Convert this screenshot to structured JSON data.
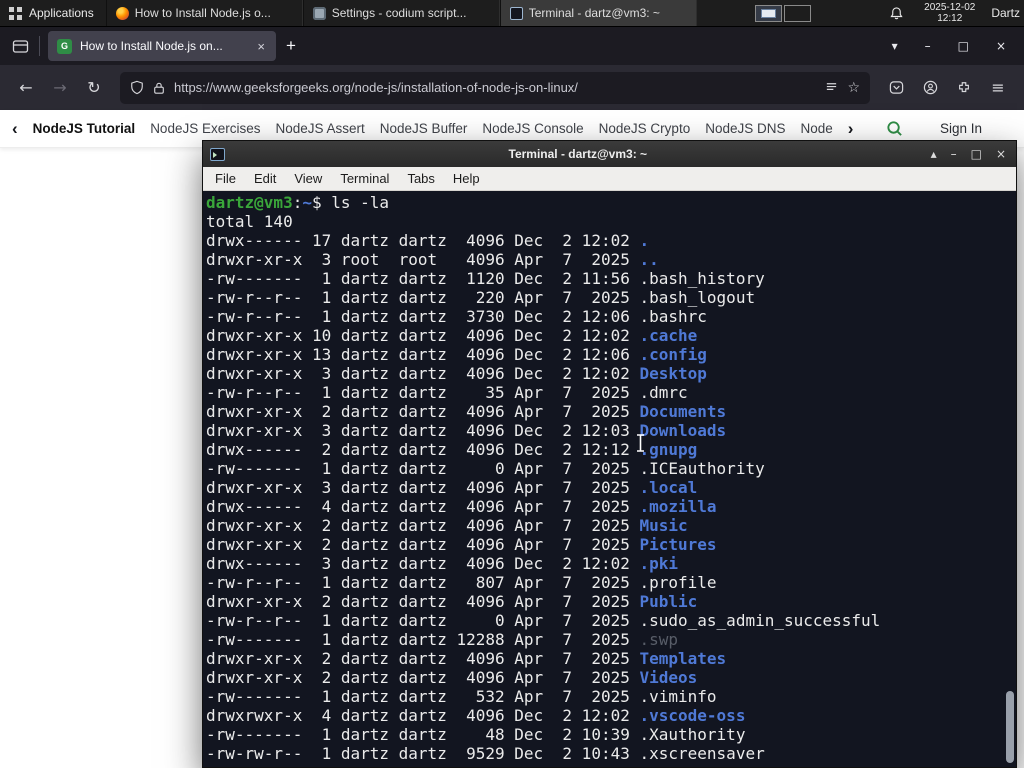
{
  "colors": {
    "gfg_green": "#2f8d46",
    "terminal_dir_blue": "#4f79d6",
    "terminal_prompt_green": "#3aa63a",
    "terminal_background": "#121520"
  },
  "panel": {
    "applications_label": "Applications",
    "tasks": [
      {
        "label": "How to Install Node.js o...",
        "icon": "firefox",
        "active": false
      },
      {
        "label": "Settings - codium script...",
        "icon": "settings",
        "active": false
      },
      {
        "label": "Terminal - dartz@vm3: ~",
        "icon": "terminal",
        "active": true
      }
    ],
    "clock": {
      "date": "2025-12-02",
      "time": "12:12"
    },
    "user": "Dartz"
  },
  "browser": {
    "tab": {
      "title": "How to Install Node.js on...",
      "favicon_letter": "G",
      "close_glyph": "×"
    },
    "new_tab_label": "+",
    "window_controls": {
      "list_tabs": "▾",
      "minimize": "–",
      "maximize": "□",
      "close": "×"
    },
    "url": "https://www.geeksforgeeks.org/node-js/installation-of-node-js-on-linux/",
    "toolbar_glyphs": {
      "back": "←",
      "forward": "→",
      "reload": "↻",
      "bookmark": "☆",
      "menu": "≡"
    },
    "gfg_nav": {
      "scroll_left": "‹",
      "scroll_right": "›",
      "links": [
        {
          "label": "NodeJS Tutorial",
          "bold": true
        },
        {
          "label": "NodeJS Exercises",
          "bold": false
        },
        {
          "label": "NodeJS Assert",
          "bold": false
        },
        {
          "label": "NodeJS Buffer",
          "bold": false
        },
        {
          "label": "NodeJS Console",
          "bold": false
        },
        {
          "label": "NodeJS Crypto",
          "bold": false
        },
        {
          "label": "NodeJS DNS",
          "bold": false
        },
        {
          "label": "Node",
          "bold": false
        }
      ],
      "sign_in": "Sign In"
    }
  },
  "terminal": {
    "title": "Terminal - dartz@vm3: ~",
    "menu": [
      "File",
      "Edit",
      "View",
      "Terminal",
      "Tabs",
      "Help"
    ],
    "window_controls": {
      "shade": "▴",
      "minimize": "–",
      "maximize": "□",
      "close": "×"
    },
    "prompt": {
      "userhost": "dartz@vm3",
      "colon": ":",
      "path": "~",
      "symbol": "$ ",
      "command": "ls -la"
    },
    "lines": [
      {
        "pre": "total 140",
        "name": "",
        "type": "plain"
      },
      {
        "pre": "drwx------ 17 dartz dartz  4096 Dec  2 12:02 ",
        "name": ".",
        "type": "dir"
      },
      {
        "pre": "drwxr-xr-x  3 root  root   4096 Apr  7  2025 ",
        "name": "..",
        "type": "dir"
      },
      {
        "pre": "-rw-------  1 dartz dartz  1120 Dec  2 11:56 ",
        "name": ".bash_history",
        "type": "file"
      },
      {
        "pre": "-rw-r--r--  1 dartz dartz   220 Apr  7  2025 ",
        "name": ".bash_logout",
        "type": "file"
      },
      {
        "pre": "-rw-r--r--  1 dartz dartz  3730 Dec  2 12:06 ",
        "name": ".bashrc",
        "type": "file"
      },
      {
        "pre": "drwxr-xr-x 10 dartz dartz  4096 Dec  2 12:02 ",
        "name": ".cache",
        "type": "dir"
      },
      {
        "pre": "drwxr-xr-x 13 dartz dartz  4096 Dec  2 12:06 ",
        "name": ".config",
        "type": "dir"
      },
      {
        "pre": "drwxr-xr-x  3 dartz dartz  4096 Dec  2 12:02 ",
        "name": "Desktop",
        "type": "dir"
      },
      {
        "pre": "-rw-r--r--  1 dartz dartz    35 Apr  7  2025 ",
        "name": ".dmrc",
        "type": "file"
      },
      {
        "pre": "drwxr-xr-x  2 dartz dartz  4096 Apr  7  2025 ",
        "name": "Documents",
        "type": "dir"
      },
      {
        "pre": "drwxr-xr-x  3 dartz dartz  4096 Dec  2 12:03 ",
        "name": "Downloads",
        "type": "dir"
      },
      {
        "pre": "drwx------  2 dartz dartz  4096 Dec  2 12:12 ",
        "name": ".gnupg",
        "type": "dir"
      },
      {
        "pre": "-rw-------  1 dartz dartz     0 Apr  7  2025 ",
        "name": ".ICEauthority",
        "type": "file"
      },
      {
        "pre": "drwxr-xr-x  3 dartz dartz  4096 Apr  7  2025 ",
        "name": ".local",
        "type": "dir"
      },
      {
        "pre": "drwx------  4 dartz dartz  4096 Apr  7  2025 ",
        "name": ".mozilla",
        "type": "dir"
      },
      {
        "pre": "drwxr-xr-x  2 dartz dartz  4096 Apr  7  2025 ",
        "name": "Music",
        "type": "dir"
      },
      {
        "pre": "drwxr-xr-x  2 dartz dartz  4096 Apr  7  2025 ",
        "name": "Pictures",
        "type": "dir"
      },
      {
        "pre": "drwx------  3 dartz dartz  4096 Dec  2 12:02 ",
        "name": ".pki",
        "type": "dir"
      },
      {
        "pre": "-rw-r--r--  1 dartz dartz   807 Apr  7  2025 ",
        "name": ".profile",
        "type": "file"
      },
      {
        "pre": "drwxr-xr-x  2 dartz dartz  4096 Apr  7  2025 ",
        "name": "Public",
        "type": "dir"
      },
      {
        "pre": "-rw-r--r--  1 dartz dartz     0 Apr  7  2025 ",
        "name": ".sudo_as_admin_successful",
        "type": "file"
      },
      {
        "pre": "-rw-------  1 dartz dartz 12288 Apr  7  2025 ",
        "name": ".swp",
        "type": "dim"
      },
      {
        "pre": "drwxr-xr-x  2 dartz dartz  4096 Apr  7  2025 ",
        "name": "Templates",
        "type": "dir"
      },
      {
        "pre": "drwxr-xr-x  2 dartz dartz  4096 Apr  7  2025 ",
        "name": "Videos",
        "type": "dir"
      },
      {
        "pre": "-rw-------  1 dartz dartz   532 Apr  7  2025 ",
        "name": ".viminfo",
        "type": "file"
      },
      {
        "pre": "drwxrwxr-x  4 dartz dartz  4096 Dec  2 12:02 ",
        "name": ".vscode-oss",
        "type": "dir"
      },
      {
        "pre": "-rw-------  1 dartz dartz    48 Dec  2 10:39 ",
        "name": ".Xauthority",
        "type": "file"
      },
      {
        "pre": "-rw-rw-r--  1 dartz dartz  9529 Dec  2 10:43 ",
        "name": ".xscreensaver",
        "type": "file"
      }
    ]
  }
}
